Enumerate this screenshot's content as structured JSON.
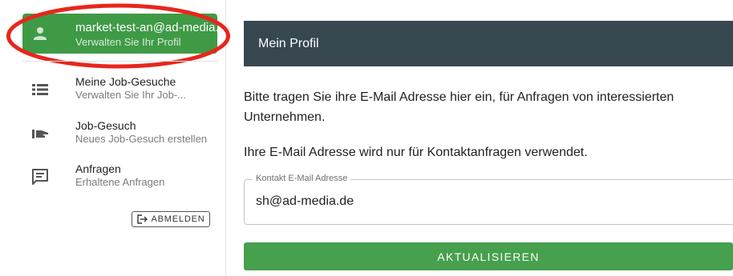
{
  "sidebar": {
    "profile": {
      "title": "market-test-an@ad-media...",
      "subtitle": "Verwalten Sie Ihr Profil",
      "icon": "person-icon"
    },
    "items": [
      {
        "title": "Meine Job-Gesuche",
        "subtitle": "Verwalten Sie Ihr Job-...",
        "icon": "list-icon"
      },
      {
        "title": "Job-Gesuch",
        "subtitle": "Neues Job-Gesuch erstellen",
        "icon": "hand-icon"
      },
      {
        "title": "Anfragen",
        "subtitle": "Erhaltene Anfragen",
        "icon": "chat-icon"
      }
    ],
    "logout_label": "ABMELDEN"
  },
  "main": {
    "header_title": "Mein Profil",
    "intro_text": "Bitte tragen Sie ihre E-Mail Adresse hier ein, für Anfragen von interessierten Unternehmen.",
    "note_text": "Ihre E-Mail Adresse wird nur für Kontaktanfragen verwendet.",
    "email_field": {
      "label": "Kontakt E-Mail Adresse",
      "value": "sh@ad-media.de"
    },
    "submit_label": "AKTUALISIEREN"
  },
  "colors": {
    "accent_green": "#3f9a45",
    "header_dark": "#37474f",
    "annotation_red": "#e8261c"
  }
}
